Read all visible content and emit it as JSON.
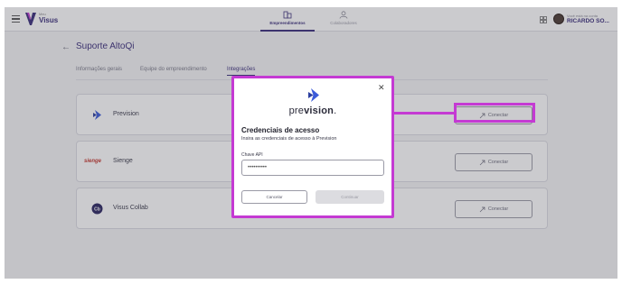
{
  "colors": {
    "brand": "#3a2d7a",
    "highlight": "#c43ad3",
    "prevision_blue": "#3b5bd9",
    "sienge_red": "#c4362e"
  },
  "header": {
    "logo_small": "Meu",
    "logo_text": "Visus",
    "nav": [
      {
        "label": "Empreendimentos",
        "icon": "building-icon",
        "active": true
      },
      {
        "label": "Colaboradores",
        "icon": "users-icon",
        "active": false
      }
    ],
    "user_small": "Você está na conta",
    "user_name": "RICARDO SO..."
  },
  "page": {
    "title": "Suporte AltoQi",
    "tabs": [
      {
        "label": "Informações gerais",
        "active": false
      },
      {
        "label": "Equipe do empreendimento",
        "active": false
      },
      {
        "label": "Integrações",
        "active": true
      }
    ]
  },
  "integrations": [
    {
      "name": "Prevision",
      "icon": "prevision-logo-icon",
      "button": "Conectar"
    },
    {
      "name": "Sienge",
      "logo_text": "sienge",
      "button": "Conectar"
    },
    {
      "name": "Visus Collab",
      "icon": "visus-collab-icon",
      "button": "Conectar"
    }
  ],
  "modal": {
    "close": "✕",
    "brand_pre": "pre",
    "brand_bold": "vision",
    "brand_dot": ".",
    "title": "Credenciais de acesso",
    "subtitle": "Insira as credenciais de acesso à Prevision",
    "field_label": "Chave API",
    "field_value": "••••••••••",
    "cancel": "Cancelar",
    "continue": "Continuar"
  }
}
